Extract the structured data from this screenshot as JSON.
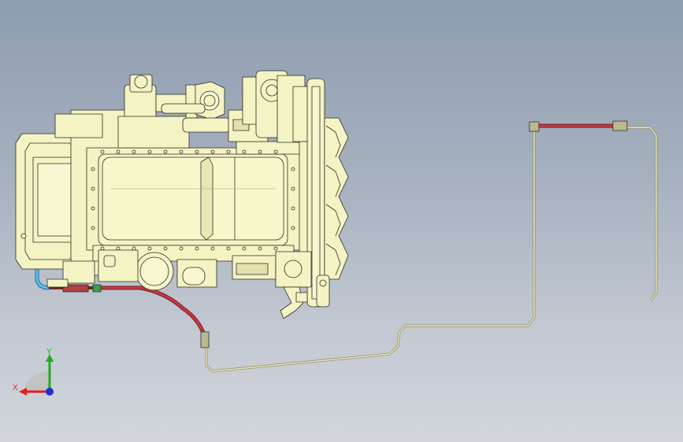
{
  "viewport": {
    "colors": {
      "background_top": "#8f9db0",
      "background_bottom": "#d2d6dc",
      "part_body": "#f4f3c4",
      "part_edge": "#2c2c22",
      "pipe_red": "#b8303a",
      "pipe_green": "#3aa04a",
      "pipe_blue": "#36a8e0"
    }
  },
  "triad": {
    "x_label": "X",
    "y_label": "Y",
    "x_color": "#e02020",
    "y_color": "#18b018",
    "z_color": "#2030d0"
  }
}
